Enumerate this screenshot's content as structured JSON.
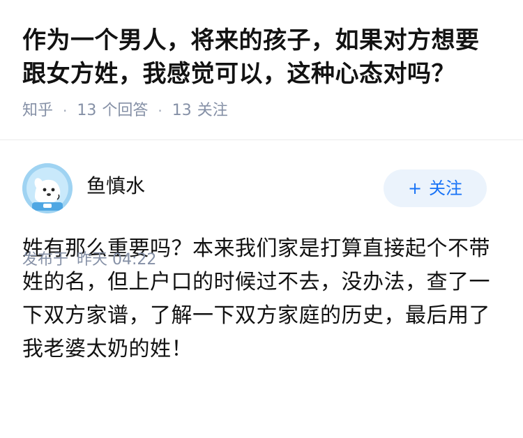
{
  "question": {
    "title": "作为一个男人，将来的孩子，如果对方想要跟女方姓，我感觉可以，这种心态对吗？",
    "source": "知乎",
    "answer_count": "13",
    "answer_label": "个回答",
    "follow_count": "13",
    "follow_label": "关注"
  },
  "answer": {
    "author": {
      "name": "鱼慎水",
      "avatar_icon": "cartoon-dog-astronaut-avatar"
    },
    "follow_button": {
      "plus": "+",
      "label": "关注"
    },
    "content": "姓有那么重要吗？本来我们家是打算直接起个不带姓的名，但上户口的时候过不去，没办法，查了一下双方家谱，了解一下双方家庭的历史，最后用了我老婆太奶的姓！",
    "published_label": "发布于",
    "published_time": "昨天 04:22"
  },
  "colors": {
    "text": "#121212",
    "meta": "#8590a6",
    "accent": "#1772f6",
    "follow_bg": "#ebf3fc"
  }
}
